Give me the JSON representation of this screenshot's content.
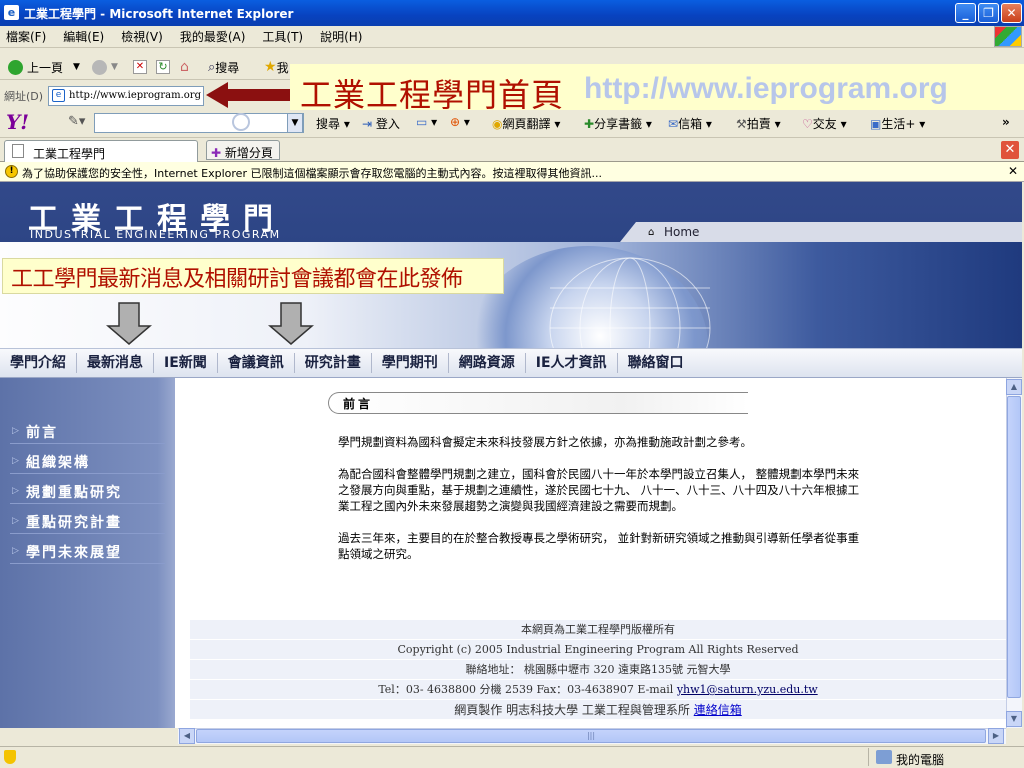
{
  "window": {
    "title": "工業工程學門 - Microsoft Internet Explorer",
    "controls": {
      "minimize": "_",
      "maximize": "❐",
      "close": "✕"
    }
  },
  "menu": [
    "檔案(F)",
    "編輯(E)",
    "檢視(V)",
    "我的最愛(A)",
    "工具(T)",
    "說明(H)"
  ],
  "toolbar": {
    "back": "上一頁",
    "search": "搜尋",
    "favorites": "我"
  },
  "address": {
    "label": "網址(D)",
    "url": "http://www.ieprogram.org"
  },
  "annotation_banner": {
    "title": "工業工程學門首頁",
    "url": "http://www.ieprogram.org"
  },
  "yahoo_toolbar": {
    "logo": "Y!",
    "search_label": "搜尋",
    "login_label": "登入",
    "items": [
      "網頁翻譯",
      "分享書籤",
      "信箱",
      "拍賣",
      "交友",
      "生活+"
    ],
    "more": "»"
  },
  "tabs": {
    "active": "工業工程學門",
    "new_tab": "新增分頁"
  },
  "infobar": {
    "text": "為了協助保護您的安全性，Internet Explorer 已限制這個檔案顯示會存取您電腦的主動式內容。按這裡取得其他資訊..."
  },
  "site": {
    "logo_cn": "工業工程學門",
    "logo_en": "INDUSTRIAL ENGINEERING PROGRAM",
    "home_label": "Home",
    "hero_caption": "工工學門最新消息及相關研討會議都會在此發佈",
    "nav": [
      "學門介紹",
      "最新消息",
      "IE新聞",
      "會議資訊",
      "研究計畫",
      "學門期刊",
      "網路資源",
      "IE人才資訊",
      "聯絡窗口"
    ],
    "sidebar": [
      "前言",
      "組織架構",
      "規劃重點研究",
      "重點研究計畫",
      "學門未來展望"
    ],
    "section_title": "前言",
    "paragraphs": [
      "學門規劃資料為國科會擬定未來科技發展方針之依據，亦為推動施政計劃之參考。",
      "為配合國科會整體學門規劃之建立，國科會於民國八十一年於本學門設立召集人， 整體規劃本學門未來之發展方向與重點，基于規劃之連續性，遂於民國七十九、 八十一、八十三、八十四及八十六年根據工業工程之國內外未來發展趨勢之演變與我國經濟建設之需要而規劃。",
      "過去三年來，主要目的在於整合教授專長之學術研究， 並針對新研究領域之推動與引導新任學者從事重點領域之研究。"
    ],
    "footer": {
      "copyright_cn": "本網頁為工業工程學門版權所有",
      "copyright_en": "Copyright (c) 2005 Industrial Engineering Program All Rights Reserved",
      "address": "聯絡地址： 桃園縣中壢市 320 遠東路135號 元智大學",
      "contact_prefix": "Tel：03- 4638800 分機 2539 Fax：03-4638907 E-mail",
      "email": "yhw1@saturn.yzu.edu.tw",
      "made_by": "網頁製作 明志科技大學 工業工程與管理系所",
      "contact_link": "連絡信箱"
    }
  },
  "status": {
    "zone": "我的電腦"
  },
  "colors": {
    "titlebar": "#0842bf",
    "annotation_red": "#b01000",
    "annotation_url": "#b7c6ea",
    "site_header": "#32498a",
    "sidebar": "#6f83b6"
  }
}
